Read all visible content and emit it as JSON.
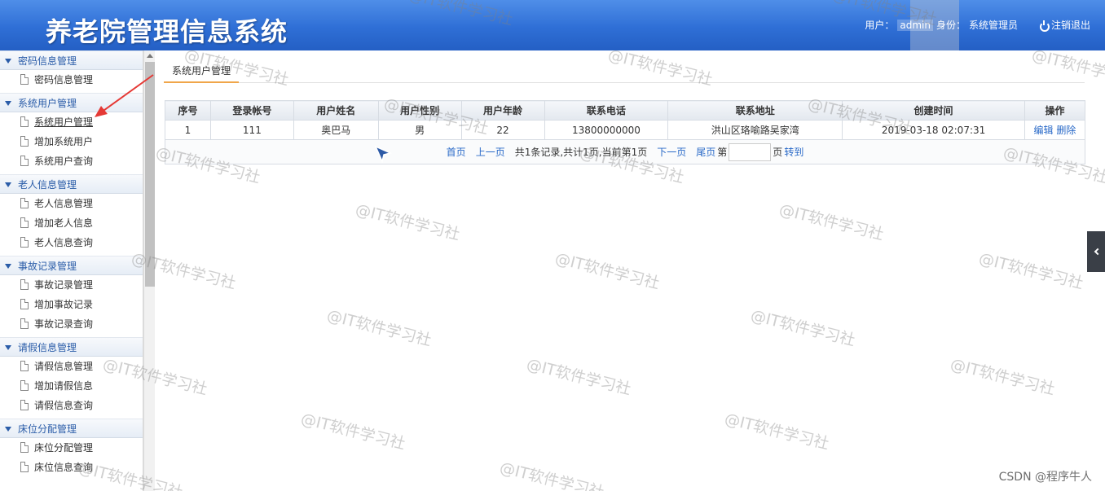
{
  "header": {
    "title": "养老院管理信息系统",
    "user_label": "用户：",
    "username": "admin",
    "role_label": "身份：",
    "role": "系统管理员",
    "logout": "注销退出"
  },
  "sidebar": {
    "groups": [
      {
        "title": "密码信息管理",
        "items": [
          "密码信息管理"
        ]
      },
      {
        "title": "系统用户管理",
        "items": [
          "系统用户管理",
          "增加系统用户",
          "系统用户查询"
        ]
      },
      {
        "title": "老人信息管理",
        "items": [
          "老人信息管理",
          "增加老人信息",
          "老人信息查询"
        ]
      },
      {
        "title": "事故记录管理",
        "items": [
          "事故记录管理",
          "增加事故记录",
          "事故记录查询"
        ]
      },
      {
        "title": "请假信息管理",
        "items": [
          "请假信息管理",
          "增加请假信息",
          "请假信息查询"
        ]
      },
      {
        "title": "床位分配管理",
        "items": [
          "床位分配管理",
          "床位信息查询"
        ]
      }
    ]
  },
  "main": {
    "tab": "系统用户管理",
    "table": {
      "headers": [
        "序号",
        "登录帐号",
        "用户姓名",
        "用户性别",
        "用户年龄",
        "联系电话",
        "联系地址",
        "创建时间",
        "操作"
      ],
      "rows": [
        {
          "no": "1",
          "account": "111",
          "name": "奥巴马",
          "gender": "男",
          "age": "22",
          "phone": "13800000000",
          "address": "洪山区珞喻路吴家湾",
          "created": "2019-03-18 02:07:31",
          "edit": "编辑",
          "delete": "删除"
        }
      ]
    },
    "pager": {
      "first": "首页",
      "prev": "上一页",
      "summary": "共1条记录,共计1页,当前第1页",
      "next": "下一页",
      "last": "尾页",
      "page_prefix": "第",
      "page_suffix": "页",
      "goto": "转到",
      "page_value": ""
    }
  },
  "watermark": "@IT软件学习社",
  "footer_credit": "CSDN @程序牛人",
  "colors": {
    "header_blue": "#2f6fd6",
    "menu_blue": "#2a5ca8",
    "link_blue": "#2a6ac8",
    "tab_underline": "#f0a64a",
    "annotation_red": "#e53935"
  }
}
